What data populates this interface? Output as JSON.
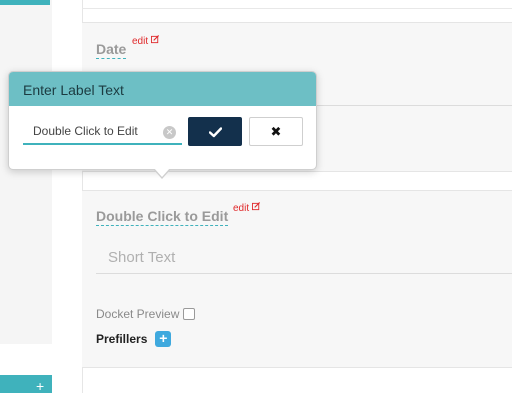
{
  "sidebar": {
    "bottom_tab_glyph": "+"
  },
  "fields": {
    "date": {
      "label": "Date",
      "edit": "edit"
    },
    "short": {
      "label": "Double Click to Edit",
      "edit": "edit",
      "placeholder": "Short Text",
      "docket_preview": "Docket Preview",
      "docket_checked": false,
      "prefillers": "Prefillers",
      "prefillers_add_icon": "plus-icon"
    }
  },
  "popover": {
    "title": "Enter Label Text",
    "input_value": "Double Click to Edit",
    "clear_icon": "clear-icon",
    "confirm_icon": "check-icon",
    "cancel_icon": "close-icon"
  },
  "colors": {
    "accent_teal": "#3fb2bc",
    "popover_header": "#6dbfc5",
    "confirm_button": "#13304c",
    "edit_red": "#e0292b",
    "add_blue": "#3fa9de"
  }
}
